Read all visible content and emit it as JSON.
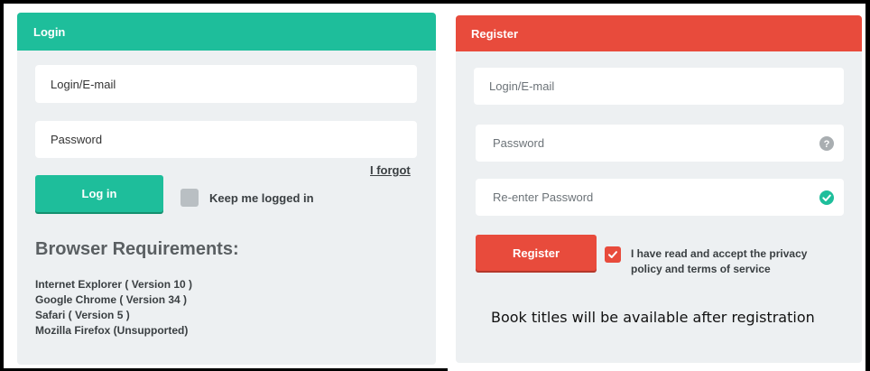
{
  "login": {
    "title": "Login",
    "login_placeholder": "Login/E-mail",
    "password_placeholder": "Password",
    "forgot_link": "I forgot",
    "login_button": "Log in",
    "keep_logged_in": "Keep me logged in",
    "browser_requirements": {
      "title": "Browser Requirements:",
      "items": [
        "Internet Explorer ( Version 10 )",
        "Google Chrome ( Version 34 )",
        "Safari ( Version 5 )",
        "Mozilla Firefox (Unsupported)"
      ]
    }
  },
  "register": {
    "title": "Register",
    "login_placeholder": "Login/E-mail",
    "password_placeholder": "Password",
    "reenter_placeholder": "Re-enter Password",
    "register_button": "Register",
    "accept_text_line1": "I have read and accept the privacy",
    "accept_text_line2": "policy and terms of service",
    "note": "Book titles will be available after registration"
  },
  "colors": {
    "login_accent": "#1ebe9b",
    "register_accent": "#e84b3c",
    "panel_bg": "#edf0f2"
  },
  "icons": {
    "password_help": "question-circle-icon",
    "reenter_valid": "check-circle-icon",
    "accept_checked": "checkmark-icon"
  }
}
